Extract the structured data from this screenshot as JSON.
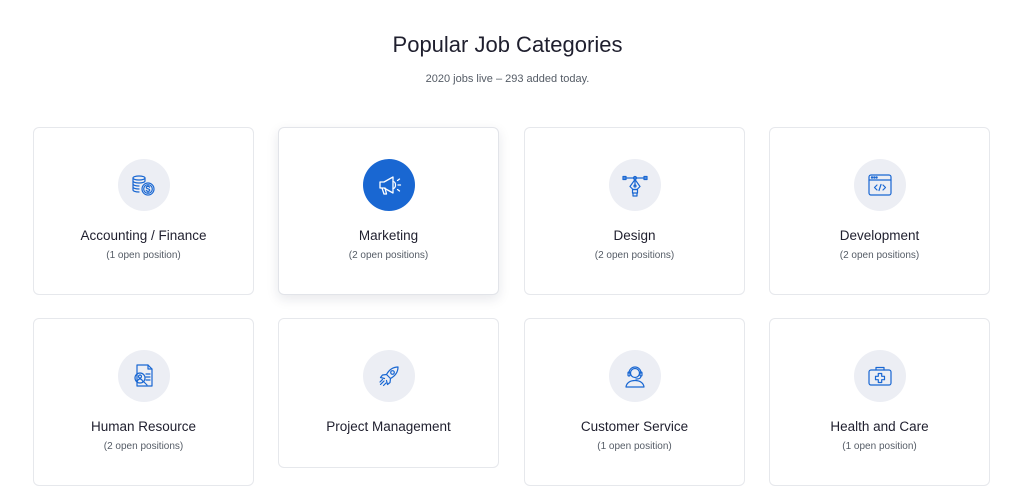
{
  "header": {
    "title": "Popular Job Categories",
    "subtitle": "2020 jobs live – 293 added today."
  },
  "colors": {
    "accent": "#1967d2",
    "icon_bg": "#eceef4"
  },
  "categories": [
    {
      "title": "Accounting / Finance",
      "count": "(1 open position)",
      "icon": "coins-dollar-icon"
    },
    {
      "title": "Marketing",
      "count": "(2 open positions)",
      "icon": "megaphone-icon"
    },
    {
      "title": "Design",
      "count": "(2 open positions)",
      "icon": "pen-tool-icon"
    },
    {
      "title": "Development",
      "count": "(2 open positions)",
      "icon": "code-window-icon"
    },
    {
      "title": "Human Resource",
      "count": "(2 open positions)",
      "icon": "resume-search-icon"
    },
    {
      "title": "Project Management",
      "count": "",
      "icon": "rocket-icon"
    },
    {
      "title": "Customer Service",
      "count": "(1 open position)",
      "icon": "headset-agent-icon"
    },
    {
      "title": "Health and Care",
      "count": "(1 open position)",
      "icon": "first-aid-kit-icon"
    }
  ]
}
